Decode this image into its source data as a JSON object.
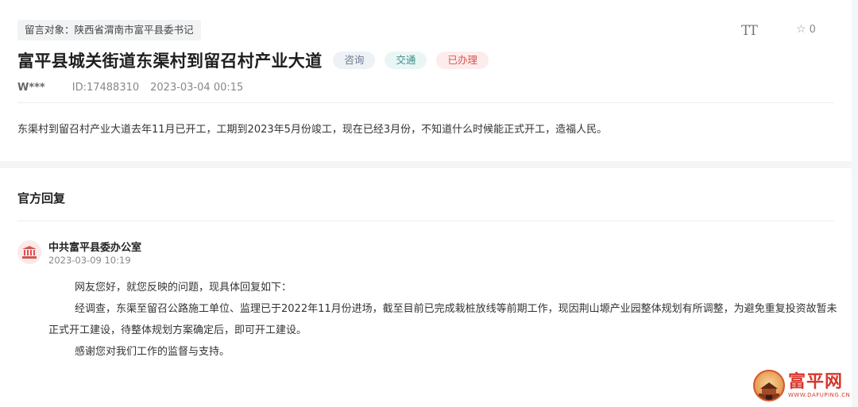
{
  "header": {
    "target_label": "留言对象：陕西省渭南市富平县委书记",
    "font_tool_label": "TT",
    "favorite_count": "0"
  },
  "message": {
    "title": "富平县城关街道东渠村到留召村产业大道",
    "tags": {
      "category": "咨询",
      "field": "交通",
      "status": "已办理"
    },
    "user": "W***",
    "id_text": "ID:17488310",
    "datetime": "2023-03-04 00:15",
    "content": "东渠村到留召村产业大道去年11月已开工，工期到2023年5月份竣工，现在已经3月份，不知道什么时候能正式开工，造福人民。"
  },
  "reply": {
    "heading": "官方回复",
    "org_name": "中共富平县委办公室",
    "date": "2023-03-09 10:19",
    "paragraphs": [
      "网友您好，就您反映的问题，现具体回复如下：",
      "经调查，东渠至留召公路施工单位、监理已于2022年11月份进场，截至目前已完成栽桩放线等前期工作，现因荆山塬产业园整体规划有所调整，为避免重复投资故暂未正式开工建设，待整体规划方案确定后，即可开工建设。",
      "感谢您对我们工作的监督与支持。"
    ]
  },
  "watermark": {
    "name": "富平网",
    "url": "WWW.DAFUPING.CN"
  },
  "colors": {
    "status_red": "#d9534f",
    "traffic_teal": "#3b8f8a",
    "consult_gray": "#6b7a90"
  }
}
